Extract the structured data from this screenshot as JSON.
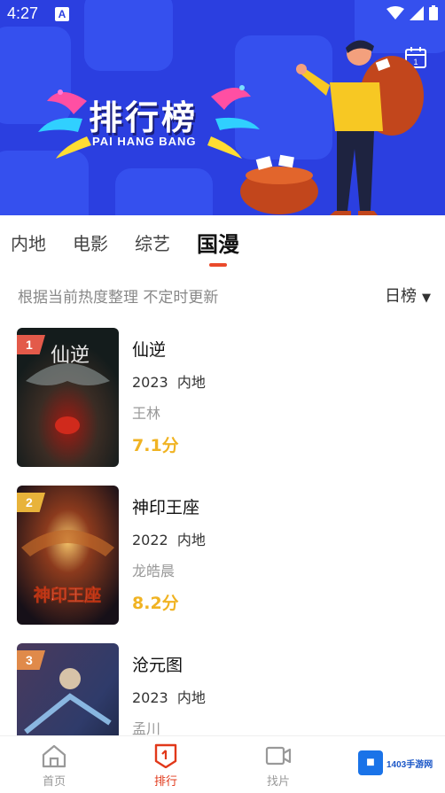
{
  "status": {
    "time": "4:27",
    "a_badge": "A"
  },
  "banner": {
    "title_zh": "排行榜",
    "title_en": "PAI HANG BANG",
    "calendar_digit": "1"
  },
  "tabs": [
    {
      "label": "内地",
      "active": false
    },
    {
      "label": "电影",
      "active": false
    },
    {
      "label": "综艺",
      "active": false
    },
    {
      "label": "国漫",
      "active": true
    }
  ],
  "subtitle": "根据当前热度整理 不定时更新",
  "sort": {
    "label": "日榜",
    "arrow": "▼"
  },
  "items": [
    {
      "rank": "1",
      "name": "仙逆",
      "year": "2023",
      "region": "内地",
      "actor": "王林",
      "score": "7.1分",
      "rank_color": "#e35a4a",
      "poster_text": "仙逆"
    },
    {
      "rank": "2",
      "name": "神印王座",
      "year": "2022",
      "region": "内地",
      "actor": "龙皓晨",
      "score": "8.2分",
      "rank_color": "#e8b33a",
      "poster_text": "神印王座"
    },
    {
      "rank": "3",
      "name": "沧元图",
      "year": "2023",
      "region": "内地",
      "actor": "孟川",
      "score": "",
      "rank_color": "#e08a4a",
      "poster_text": ""
    }
  ],
  "nav": [
    {
      "label": "首页",
      "icon": "home-icon"
    },
    {
      "label": "排行",
      "icon": "rank-icon"
    },
    {
      "label": "找片",
      "icon": "video-icon"
    }
  ],
  "watermark": {
    "logo": "■",
    "text": "1403手游网"
  },
  "colors": {
    "banner": "#2b3fe0",
    "accent": "#e1381a",
    "score": "#f0b323"
  }
}
